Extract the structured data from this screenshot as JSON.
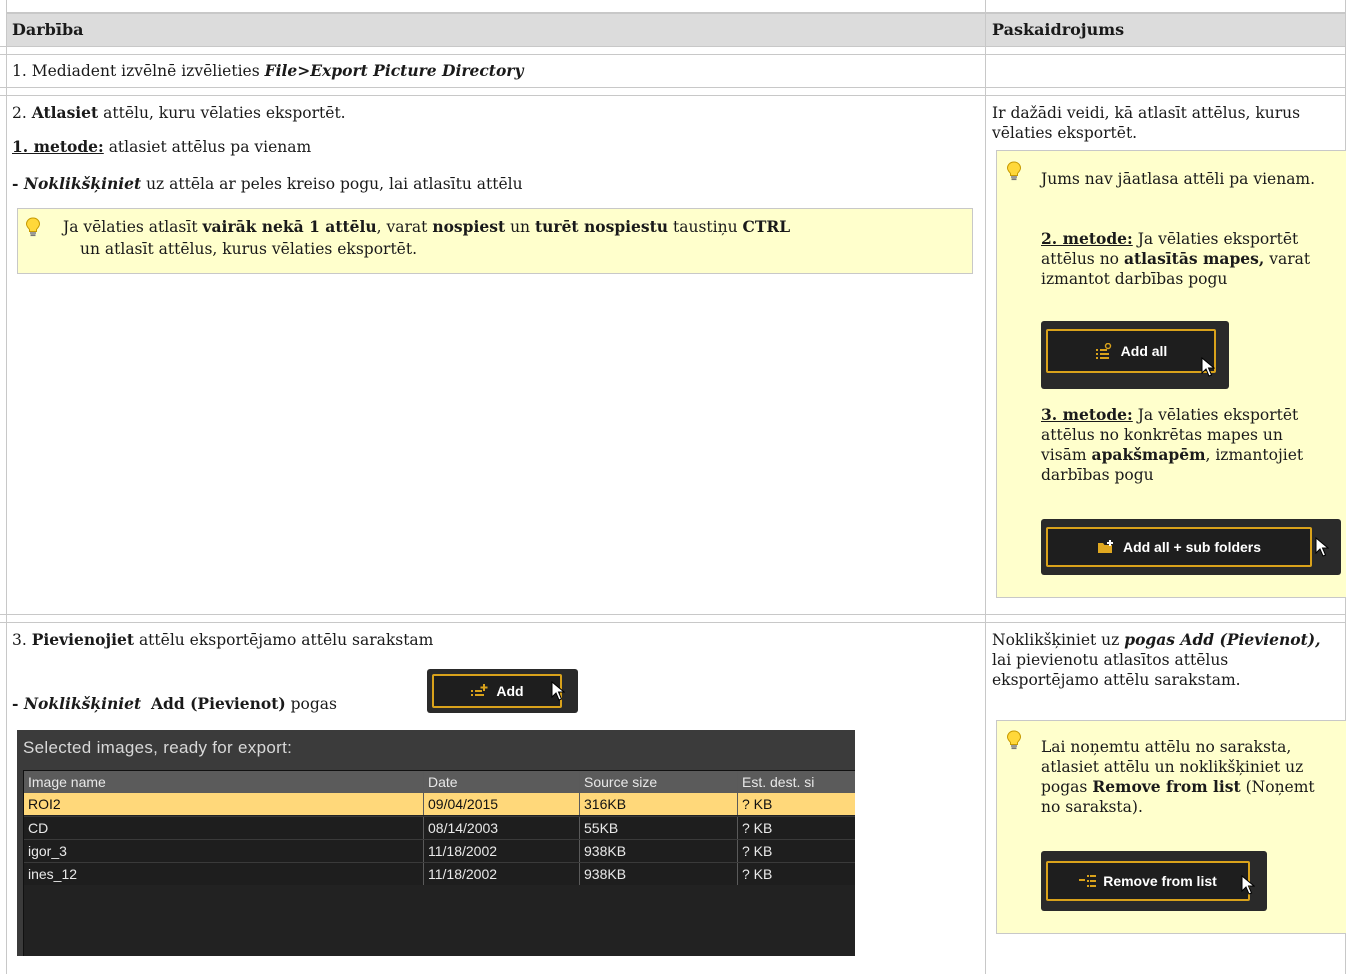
{
  "header": {
    "col1": "Darbība",
    "col2": "Paskaidrojums"
  },
  "row1": {
    "prefix": "1. Mediadent izvēlnē izvēlieties ",
    "menu_path": "File>Export Picture Directory"
  },
  "row2": {
    "step_num": "2. ",
    "step_bold": "Atlasiet",
    "step_rest": " attēlu, kuru vēlaties eksportēt.",
    "method1_label": "1. metode:",
    "method1_text": " atlasiet attēlus pa vienam",
    "click_prefix": "- ",
    "click_bold": "Noklikšķiniet",
    "click_rest": " uz attēla ar peles kreiso pogu, lai atlasītu attēlu",
    "tip": {
      "p1": "Ja vēlaties atlasīt ",
      "b1": "vairāk nekā 1 attēlu",
      "p2": ", varat ",
      "b2": "nospiest",
      "p3": " un ",
      "b3": "turēt nospiestu",
      "p4": " taustiņu ",
      "b4": "CTRL",
      "line2": "un atlasīt attēlus, kurus vēlaties eksportēt."
    },
    "explain": "Ir dažādi veidi, kā atlasīt attēlus, kurus vēlaties eksportēt.",
    "note": {
      "intro": "Jums nav jāatlasa attēli pa vienam.",
      "m2_label": "2. metode:",
      "m2_p1": " Ja vēlaties eksportēt attēlus no ",
      "m2_b": "atlasītās mapes,",
      "m2_p2": " varat izmantot darbības pogu",
      "add_all_button": "Add all",
      "m3_label": "3. metode:",
      "m3_p1": " Ja vēlaties eksportēt attēlus no konkrētas mapes un visām ",
      "m3_b": "apakšmapēm",
      "m3_p2": ", izmantojiet darbības pogu",
      "add_sub_button": "Add all + sub folders"
    }
  },
  "row3": {
    "step_num": "3. ",
    "step_bold": "Pievienojiet",
    "step_rest": " attēlu eksportējamo attēlu sarakstam",
    "click_prefix": "- ",
    "click_bold": "Noklikšķiniet",
    "click_bold2": "Add (Pievienot)",
    "click_rest": " pogas",
    "add_button": "Add",
    "panel": {
      "title": "Selected images, ready for export:",
      "columns": [
        "Image name",
        "Date",
        "Source size",
        "Est. dest. si"
      ],
      "rows": [
        [
          "ROI2",
          "09/04/2015",
          "316KB",
          "? KB"
        ],
        [
          "CD",
          "08/14/2003",
          "55KB",
          "? KB"
        ],
        [
          "igor_3",
          "11/18/2002",
          "938KB",
          "? KB"
        ],
        [
          "ines_12",
          "11/18/2002",
          "938KB",
          "? KB"
        ]
      ]
    },
    "explain": {
      "p1": "Noklikšķiniet uz ",
      "bi": "pogas Add (Pievienot),",
      "p2": " lai pievienotu atlasītos attēlus eksportējamo attēlu sarakstam."
    },
    "note": {
      "p1": "Lai noņemtu attēlu no saraksta, atlasiet attēlu un noklikšķiniet uz pogas ",
      "b": "Remove from list",
      "p2": " (Noņemt no saraksta).",
      "remove_button": "Remove from list"
    }
  }
}
